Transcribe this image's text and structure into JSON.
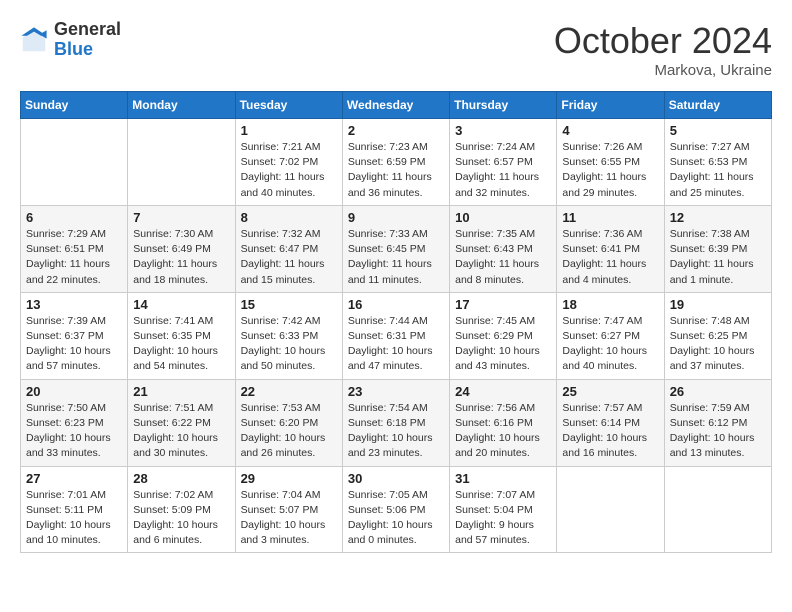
{
  "logo": {
    "general": "General",
    "blue": "Blue"
  },
  "header": {
    "month": "October 2024",
    "location": "Markova, Ukraine"
  },
  "weekdays": [
    "Sunday",
    "Monday",
    "Tuesday",
    "Wednesday",
    "Thursday",
    "Friday",
    "Saturday"
  ],
  "weeks": [
    [
      {
        "day": "",
        "info": ""
      },
      {
        "day": "",
        "info": ""
      },
      {
        "day": "1",
        "info": "Sunrise: 7:21 AM\nSunset: 7:02 PM\nDaylight: 11 hours and 40 minutes."
      },
      {
        "day": "2",
        "info": "Sunrise: 7:23 AM\nSunset: 6:59 PM\nDaylight: 11 hours and 36 minutes."
      },
      {
        "day": "3",
        "info": "Sunrise: 7:24 AM\nSunset: 6:57 PM\nDaylight: 11 hours and 32 minutes."
      },
      {
        "day": "4",
        "info": "Sunrise: 7:26 AM\nSunset: 6:55 PM\nDaylight: 11 hours and 29 minutes."
      },
      {
        "day": "5",
        "info": "Sunrise: 7:27 AM\nSunset: 6:53 PM\nDaylight: 11 hours and 25 minutes."
      }
    ],
    [
      {
        "day": "6",
        "info": "Sunrise: 7:29 AM\nSunset: 6:51 PM\nDaylight: 11 hours and 22 minutes."
      },
      {
        "day": "7",
        "info": "Sunrise: 7:30 AM\nSunset: 6:49 PM\nDaylight: 11 hours and 18 minutes."
      },
      {
        "day": "8",
        "info": "Sunrise: 7:32 AM\nSunset: 6:47 PM\nDaylight: 11 hours and 15 minutes."
      },
      {
        "day": "9",
        "info": "Sunrise: 7:33 AM\nSunset: 6:45 PM\nDaylight: 11 hours and 11 minutes."
      },
      {
        "day": "10",
        "info": "Sunrise: 7:35 AM\nSunset: 6:43 PM\nDaylight: 11 hours and 8 minutes."
      },
      {
        "day": "11",
        "info": "Sunrise: 7:36 AM\nSunset: 6:41 PM\nDaylight: 11 hours and 4 minutes."
      },
      {
        "day": "12",
        "info": "Sunrise: 7:38 AM\nSunset: 6:39 PM\nDaylight: 11 hours and 1 minute."
      }
    ],
    [
      {
        "day": "13",
        "info": "Sunrise: 7:39 AM\nSunset: 6:37 PM\nDaylight: 10 hours and 57 minutes."
      },
      {
        "day": "14",
        "info": "Sunrise: 7:41 AM\nSunset: 6:35 PM\nDaylight: 10 hours and 54 minutes."
      },
      {
        "day": "15",
        "info": "Sunrise: 7:42 AM\nSunset: 6:33 PM\nDaylight: 10 hours and 50 minutes."
      },
      {
        "day": "16",
        "info": "Sunrise: 7:44 AM\nSunset: 6:31 PM\nDaylight: 10 hours and 47 minutes."
      },
      {
        "day": "17",
        "info": "Sunrise: 7:45 AM\nSunset: 6:29 PM\nDaylight: 10 hours and 43 minutes."
      },
      {
        "day": "18",
        "info": "Sunrise: 7:47 AM\nSunset: 6:27 PM\nDaylight: 10 hours and 40 minutes."
      },
      {
        "day": "19",
        "info": "Sunrise: 7:48 AM\nSunset: 6:25 PM\nDaylight: 10 hours and 37 minutes."
      }
    ],
    [
      {
        "day": "20",
        "info": "Sunrise: 7:50 AM\nSunset: 6:23 PM\nDaylight: 10 hours and 33 minutes."
      },
      {
        "day": "21",
        "info": "Sunrise: 7:51 AM\nSunset: 6:22 PM\nDaylight: 10 hours and 30 minutes."
      },
      {
        "day": "22",
        "info": "Sunrise: 7:53 AM\nSunset: 6:20 PM\nDaylight: 10 hours and 26 minutes."
      },
      {
        "day": "23",
        "info": "Sunrise: 7:54 AM\nSunset: 6:18 PM\nDaylight: 10 hours and 23 minutes."
      },
      {
        "day": "24",
        "info": "Sunrise: 7:56 AM\nSunset: 6:16 PM\nDaylight: 10 hours and 20 minutes."
      },
      {
        "day": "25",
        "info": "Sunrise: 7:57 AM\nSunset: 6:14 PM\nDaylight: 10 hours and 16 minutes."
      },
      {
        "day": "26",
        "info": "Sunrise: 7:59 AM\nSunset: 6:12 PM\nDaylight: 10 hours and 13 minutes."
      }
    ],
    [
      {
        "day": "27",
        "info": "Sunrise: 7:01 AM\nSunset: 5:11 PM\nDaylight: 10 hours and 10 minutes."
      },
      {
        "day": "28",
        "info": "Sunrise: 7:02 AM\nSunset: 5:09 PM\nDaylight: 10 hours and 6 minutes."
      },
      {
        "day": "29",
        "info": "Sunrise: 7:04 AM\nSunset: 5:07 PM\nDaylight: 10 hours and 3 minutes."
      },
      {
        "day": "30",
        "info": "Sunrise: 7:05 AM\nSunset: 5:06 PM\nDaylight: 10 hours and 0 minutes."
      },
      {
        "day": "31",
        "info": "Sunrise: 7:07 AM\nSunset: 5:04 PM\nDaylight: 9 hours and 57 minutes."
      },
      {
        "day": "",
        "info": ""
      },
      {
        "day": "",
        "info": ""
      }
    ]
  ]
}
